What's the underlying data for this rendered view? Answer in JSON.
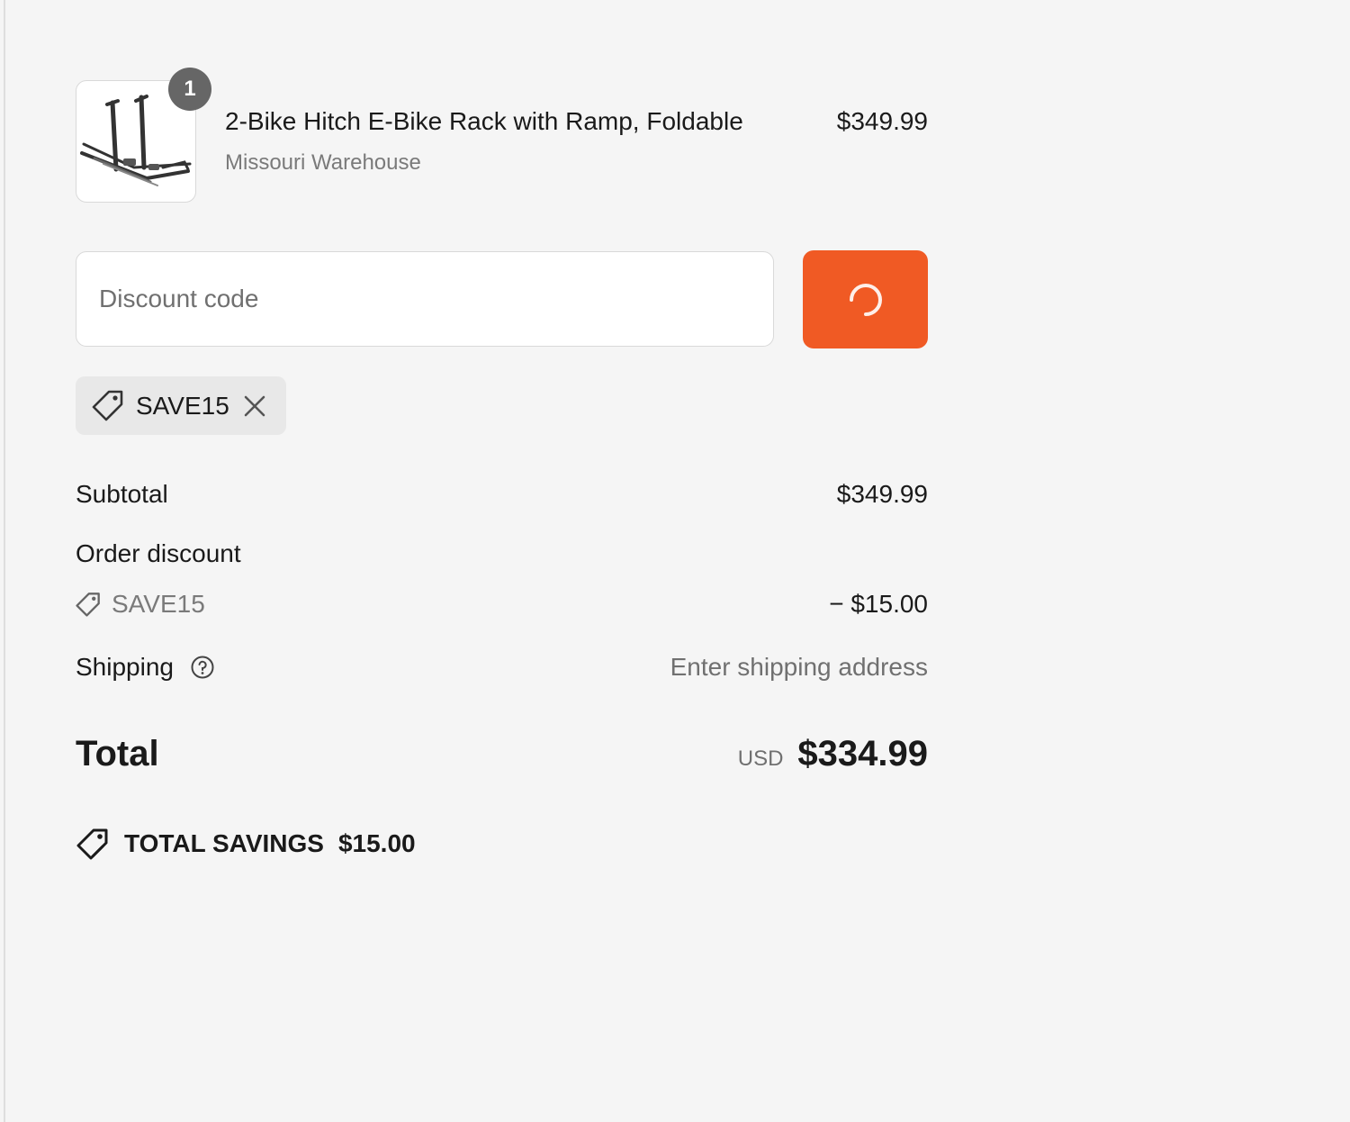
{
  "cart": {
    "item": {
      "quantity": "1",
      "name": "2-Bike Hitch E-Bike Rack with Ramp, Foldable",
      "variant": "Missouri Warehouse",
      "price": "$349.99"
    }
  },
  "discount": {
    "placeholder": "Discount code",
    "value": "",
    "apply_state": "loading",
    "applied_code": "SAVE15"
  },
  "summary": {
    "subtotal_label": "Subtotal",
    "subtotal_value": "$349.99",
    "order_discount_label": "Order discount",
    "discount_code": "SAVE15",
    "discount_value": "− $15.00",
    "shipping_label": "Shipping",
    "shipping_value": "Enter shipping address",
    "total_label": "Total",
    "total_currency": "USD",
    "total_value": "$334.99",
    "savings_label": "TOTAL SAVINGS",
    "savings_value": "$15.00"
  },
  "colors": {
    "accent": "#f05a24",
    "background": "#f5f5f5",
    "badge": "#666666"
  },
  "icons": [
    "product-thumbnail",
    "spinner-icon",
    "tag-icon",
    "close-icon",
    "help-icon",
    "savings-tag-icon"
  ]
}
